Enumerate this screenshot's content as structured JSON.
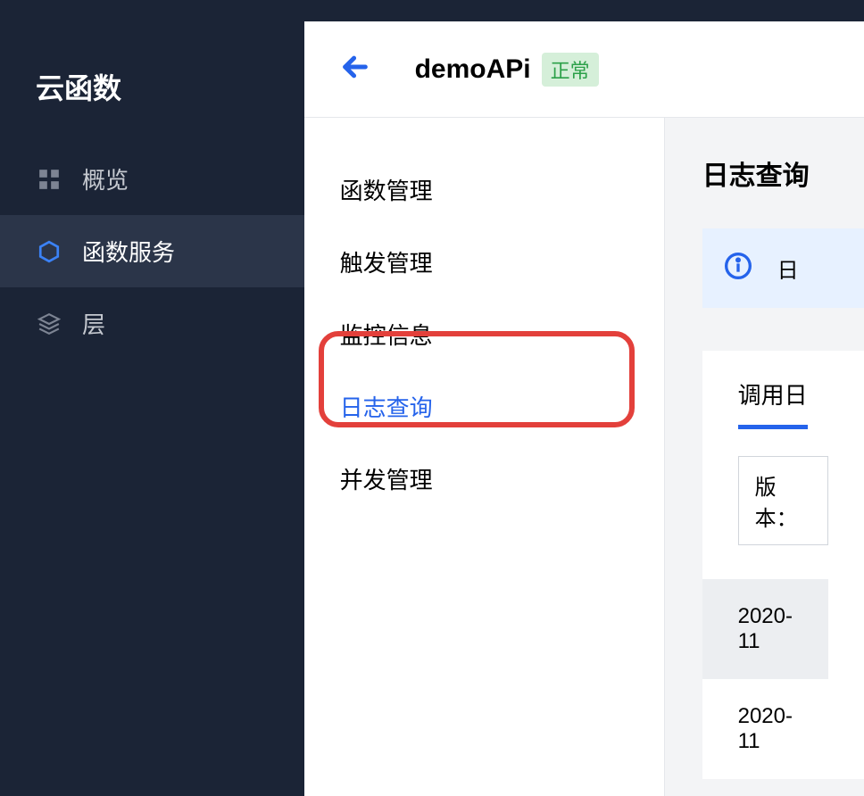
{
  "sidebar": {
    "title": "云函数",
    "items": [
      {
        "label": "概览",
        "icon": "grid"
      },
      {
        "label": "函数服务",
        "icon": "hexagon"
      },
      {
        "label": "层",
        "icon": "layers"
      }
    ]
  },
  "header": {
    "title": "demoAPi",
    "status": "正常"
  },
  "subnav": {
    "items": [
      {
        "label": "函数管理"
      },
      {
        "label": "触发管理"
      },
      {
        "label": "监控信息"
      },
      {
        "label": "日志查询"
      },
      {
        "label": "并发管理"
      }
    ]
  },
  "panel": {
    "title": "日志查询",
    "info_text": "日",
    "tab": "调用日",
    "version_label": "版本：",
    "logs": [
      "2020-11",
      "2020-11"
    ]
  }
}
